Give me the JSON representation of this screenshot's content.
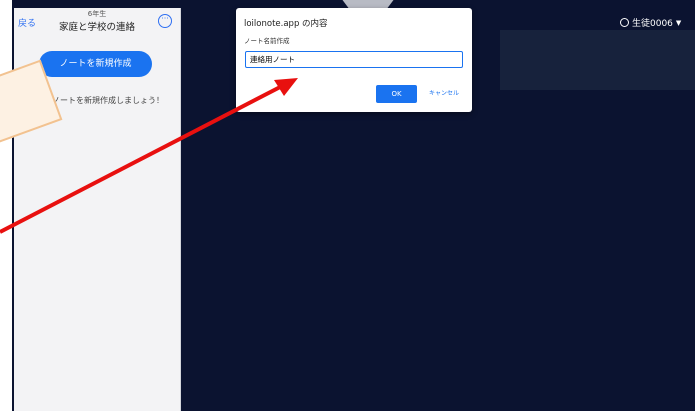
{
  "sidebar": {
    "back_label": "戻る",
    "grade": "6年生",
    "title": "家庭と学校の連絡",
    "more_icon": "more-icon",
    "new_note_label": "ノートを新規作成",
    "empty_hint": "ノートを新規作成しましょう！"
  },
  "header": {
    "user_label": "生徒0006",
    "user_icon": "user-icon"
  },
  "dialog": {
    "title": "loilonote.app の内容",
    "message": "ノート名前作成",
    "input_value": "連絡用ノート",
    "ok_label": "OK",
    "cancel_label": "キャンセル"
  },
  "colors": {
    "app_background": "#0b1330",
    "accent": "#1a73f0",
    "annotation_arrow": "#e8100f",
    "callout": "#f2c290"
  }
}
